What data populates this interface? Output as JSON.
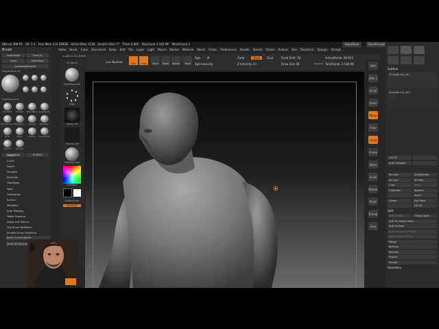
{
  "title_bar": {
    "app": "ZBrush 4R8 P2",
    "version": "3D: 1.4",
    "stats": [
      "Free Mem 124.289GB",
      "Active Mem 1238",
      "Scratch Disk 77",
      "Timer 0.005",
      "PolyCount 2.442 MP",
      "MeshCount 2"
    ],
    "quicksave": "QuickSave",
    "seethrough": "See-through 0",
    "menus": "Menus",
    "script": "DefaultZScript"
  },
  "menu_bar": [
    "Alpha",
    "Brush",
    "Color",
    "Document",
    "Draw",
    "Edit",
    "File",
    "Layer",
    "Light",
    "Macro",
    "Marker",
    "Material",
    "Movie",
    "Picker",
    "Preferences",
    "Render",
    "Stencil",
    "Stroke",
    "Texture",
    "Tool",
    "Transform",
    "Zplugin",
    "Zscript"
  ],
  "left_panel": {
    "title": "Brush",
    "buttons": [
      [
        "Load Brush",
        "Save As"
      ],
      [
        "Clone",
        "SelectAlso"
      ],
      [
        "Lightbox▸Brushes",
        ""
      ]
    ],
    "size_label": "ClayBuildup  2R",
    "brushes": [
      "ClayBuildup",
      "Clay",
      "ClayTubes",
      "DamStandard",
      "Inflate",
      "Move",
      "Pinch",
      "Standard",
      "Smooth",
      "SelectRect",
      "Snakehook",
      "TrimDynamic",
      "MoveTopo",
      "hPolish",
      "ZModeler",
      "Blob",
      "Move",
      "Flatten",
      "CurveTube",
      "aPolish",
      "Smooth"
    ],
    "from_mesh": "From Mesh",
    "to_mesh": "To Mesh",
    "sections": [
      "Create",
      "Curve",
      "Depth",
      "Samples",
      "Elasticity",
      "FiberMesh",
      "Twist",
      "Orientation",
      "Surface",
      "Modifiers",
      "Auto Masking",
      "Tablet Pressure",
      "Alpha and Texture",
      "Clip Brush Modifiers",
      "Smooth Brush Modifiers"
    ],
    "reset_current": "Reset Current Brush",
    "reset_all": "Reset All Brushes"
  },
  "shelf": {
    "lightbox": "LB Alpha",
    "brush": "DamStandard",
    "stroke": "Dots",
    "alpha": "Alpha Off",
    "texture": "Texture Off",
    "material": "MatCap Gray",
    "gradient": "Gradient",
    "switch": "SwitchColor",
    "alternate": "Alternate"
  },
  "top_bar": {
    "live_boolean": "Live Boolean",
    "edit": "Edit",
    "draw": "Draw",
    "move": "Move",
    "scale": "Scale",
    "rotate": "Rotate",
    "mrgb": "Mrgb",
    "rgb": "Rgb",
    "m": "M",
    "rgb_intensity": "Rgb Intensity",
    "zadd": "Zadd",
    "zsub": "Zsub",
    "zcut": "Zcut",
    "z_intensity": "Z Intensity 33",
    "focal_shift": "Focal Shift -52",
    "draw_size": "Draw Size 48",
    "dynamic": "Dynamic",
    "active_points": "ActivePoints: 89,624",
    "total_points": "TotalPoints: 2.548 Mil",
    "coords": "-1.429,-2.711,0.902"
  },
  "right_shelf": [
    "BPR",
    "SPix 3",
    "Scroll",
    "Zoom",
    "Actual",
    "AAHalf",
    "Persp",
    "Floor",
    "Local",
    "L.Sym",
    "Frame",
    "Move",
    "Scale",
    "Rotate",
    "Line Fill",
    "PolyF",
    "Transp",
    "Ghost",
    "Dynamic",
    "Solo",
    "Xpose"
  ],
  "right_panel": {
    "tool_thumbs": [
      "SimpleBrush",
      "PM3D_Nameless1",
      "PM3D_SimpleBrush",
      "CylinderB",
      "PolyMesh3D",
      "SimpleBrush"
    ],
    "subtool_title": "Subtool",
    "subtools": [
      "SimpleBrush_001",
      "SimpleBrush_002"
    ],
    "list_all": "List All",
    "auto_collapse": "Auto Collapse",
    "actions": [
      [
        "Rename",
        "AutoReorder"
      ],
      [
        "All Low",
        "All High"
      ],
      [
        "Copy",
        "Paste"
      ],
      [
        "Duplicate",
        "Append"
      ],
      [
        "",
        "Insert"
      ],
      [
        "Delete",
        "Del Other"
      ],
      [
        "",
        "Del All"
      ]
    ],
    "split_title": "Split",
    "split": [
      "Split Hidden",
      "Groups Split",
      "Split To Similar Parts",
      "Split To Parts",
      "Split Unmasked Points",
      "Split Masked Points"
    ],
    "merge": [
      "Merge",
      "Boolean",
      "Remesh",
      "Project",
      "Extract"
    ],
    "geometry": "Geometry"
  }
}
